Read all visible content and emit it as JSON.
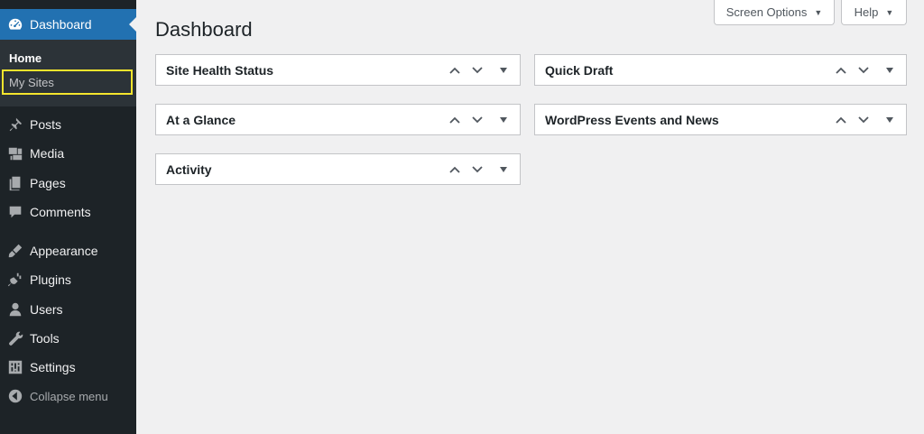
{
  "sidebar": {
    "dashboard_label": "Dashboard",
    "submenu": {
      "home": "Home",
      "my_sites": "My Sites"
    },
    "items": [
      {
        "label": "Posts",
        "icon": "pin-icon"
      },
      {
        "label": "Media",
        "icon": "media-icon"
      },
      {
        "label": "Pages",
        "icon": "pages-icon"
      },
      {
        "label": "Comments",
        "icon": "comment-icon"
      },
      {
        "label": "Appearance",
        "icon": "brush-icon"
      },
      {
        "label": "Plugins",
        "icon": "plug-icon"
      },
      {
        "label": "Users",
        "icon": "user-icon"
      },
      {
        "label": "Tools",
        "icon": "wrench-icon"
      },
      {
        "label": "Settings",
        "icon": "settings-icon"
      }
    ],
    "collapse_label": "Collapse menu"
  },
  "header": {
    "title": "Dashboard",
    "screen_options": "Screen Options",
    "help": "Help"
  },
  "panels": {
    "left": [
      "Site Health Status",
      "At a Glance",
      "Activity"
    ],
    "right": [
      "Quick Draft",
      "WordPress Events and News"
    ]
  },
  "colors": {
    "sidebar_bg": "#1d2327",
    "active_menu": "#2271b1",
    "highlight_border": "#f5e52d",
    "page_bg": "#f0f0f1"
  }
}
